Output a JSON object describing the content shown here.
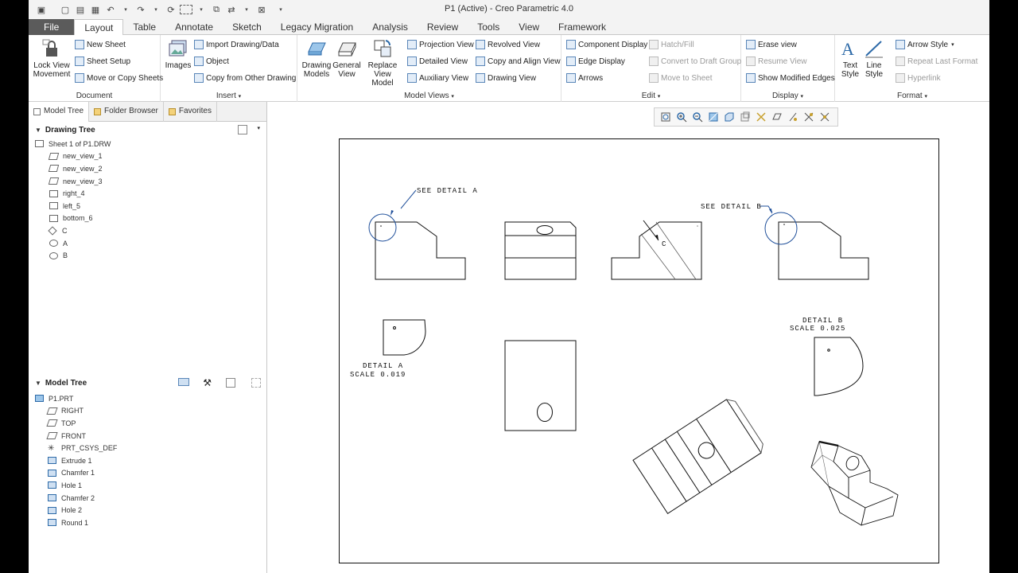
{
  "window": {
    "title": "P1 (Active) - Creo Parametric 4.0"
  },
  "tabs": [
    "File",
    "Layout",
    "Table",
    "Annotate",
    "Sketch",
    "Legacy Migration",
    "Analysis",
    "Review",
    "Tools",
    "View",
    "Framework"
  ],
  "active_tab": "Layout",
  "ribbon": {
    "document": {
      "label": "Document",
      "lock_view": "Lock View Movement",
      "new_sheet": "New Sheet",
      "sheet_setup": "Sheet Setup",
      "move_copy": "Move or Copy Sheets"
    },
    "insert": {
      "label": "Insert",
      "images": "Images",
      "import": "Import Drawing/Data",
      "object": "Object",
      "copy_from": "Copy from Other Drawing"
    },
    "model_views": {
      "label": "Model Views",
      "drawing_models": "Drawing Models",
      "general_view": "General View",
      "replace_view": "Replace View Model",
      "projection": "Projection View",
      "detailed": "Detailed View",
      "auxiliary": "Auxiliary View",
      "revolved": "Revolved View",
      "copy_align": "Copy and Align View",
      "drawing_view": "Drawing View"
    },
    "edit": {
      "label": "Edit",
      "component_display": "Component Display",
      "edge_display": "Edge Display",
      "arrows": "Arrows",
      "hatch_fill": "Hatch/Fill",
      "convert_draft": "Convert to Draft Group",
      "move_to_sheet": "Move to Sheet"
    },
    "display": {
      "label": "Display",
      "erase_view": "Erase view",
      "resume_view": "Resume View",
      "show_modified": "Show Modified Edges"
    },
    "format": {
      "label": "Format",
      "text_style": "Text Style",
      "line_style": "Line Style",
      "arrow_style": "Arrow Style",
      "repeat_last": "Repeat Last Format",
      "hyperlink": "Hyperlink"
    }
  },
  "pane_tabs": {
    "model_tree": "Model Tree",
    "folder_browser": "Folder Browser",
    "favorites": "Favorites"
  },
  "drawing_tree": {
    "title": "Drawing Tree",
    "items": [
      "Sheet 1 of P1.DRW",
      "new_view_1",
      "new_view_2",
      "new_view_3",
      "right_4",
      "left_5",
      "bottom_6",
      "C",
      "A",
      "B"
    ]
  },
  "model_tree": {
    "title": "Model Tree",
    "items": [
      "P1.PRT",
      "RIGHT",
      "TOP",
      "FRONT",
      "PRT_CSYS_DEF",
      "Extrude 1",
      "Chamfer 1",
      "Hole 1",
      "Chamfer 2",
      "Hole 2",
      "Round 1"
    ]
  },
  "drawing": {
    "see_detail_a": "SEE DETAIL  A",
    "see_detail_b": "SEE DETAIL  B",
    "section_c": "C",
    "detail_a_title": "DETAIL  A",
    "detail_a_scale": "SCALE  0.019",
    "detail_b_title": "DETAIL  B",
    "detail_b_scale": "SCALE  0.025"
  },
  "colors": {
    "file_tab": "#5b5b5b",
    "accent": "#2a64b8",
    "annotation": "#1f4f9a"
  }
}
